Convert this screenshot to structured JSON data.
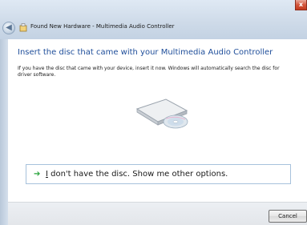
{
  "window": {
    "title": "Found New Hardware - Multimedia Audio Controller",
    "title_icon": "hardware-icon",
    "back_icon": "back-arrow-icon",
    "close_label": "x"
  },
  "content": {
    "heading": "Insert the disc that came with your Multimedia Audio Controller",
    "description": "If you have the disc that came with your device, insert it now.  Windows will automatically search the disc for driver software.",
    "illustration": "disc-drive-icon",
    "option": {
      "icon": "green-arrow-icon",
      "label_first_char": "I",
      "label_rest": " don't have the disc.  Show me other options."
    }
  },
  "footer": {
    "cancel_label": "Cancel"
  },
  "colors": {
    "heading": "#1f4e9a",
    "option_border": "#a7c2dc",
    "arrow": "#2aa43c",
    "close": "#c23a1e"
  }
}
